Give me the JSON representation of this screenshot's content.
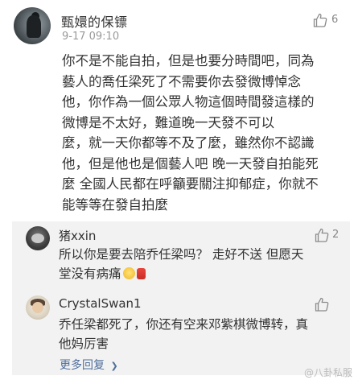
{
  "main_comment": {
    "username": "甄嬛的保镖",
    "time": "9-17 09:10",
    "like_count": "6",
    "lines": [
      "你不是不能自拍，但是也要分時間吧，同為",
      "藝人的喬任梁死了不需要你去發微博悼念",
      "他，你作為一個公眾人物這個時間發這樣的",
      "微博是不太好，難道晚一天發不可以",
      "麼，就一天你都等不及了麼，雖然你不認識",
      "他，但是他也是個藝人吧 晚一天發自拍能死",
      "麼 全國人民都在呼籲要關注抑郁症，你就不",
      "能等等在發自拍麼"
    ]
  },
  "replies": [
    {
      "username": "猪xxin",
      "like_count": "2",
      "lines": [
        "所以你是要去陪乔任梁吗？ 走好不送 但愿天",
        "堂没有病痛"
      ]
    },
    {
      "username": "CrystalSwan1",
      "lines": [
        "乔任梁都死了，你还有空来邓紫棋微博转，真",
        "他妈厉害"
      ]
    }
  ],
  "more_replies_label": "更多回复",
  "more_replies_chevron": "❯",
  "watermark": "@八卦私服",
  "icons": {
    "like": "thumbs-up-icon",
    "emoji_1": "smiley-emoji",
    "emoji_2": "red-bag-emoji"
  },
  "colors": {
    "link": "#4f6e9b",
    "reply_background": "#f2f2f2",
    "secondary_text": "#9a9a9a"
  }
}
